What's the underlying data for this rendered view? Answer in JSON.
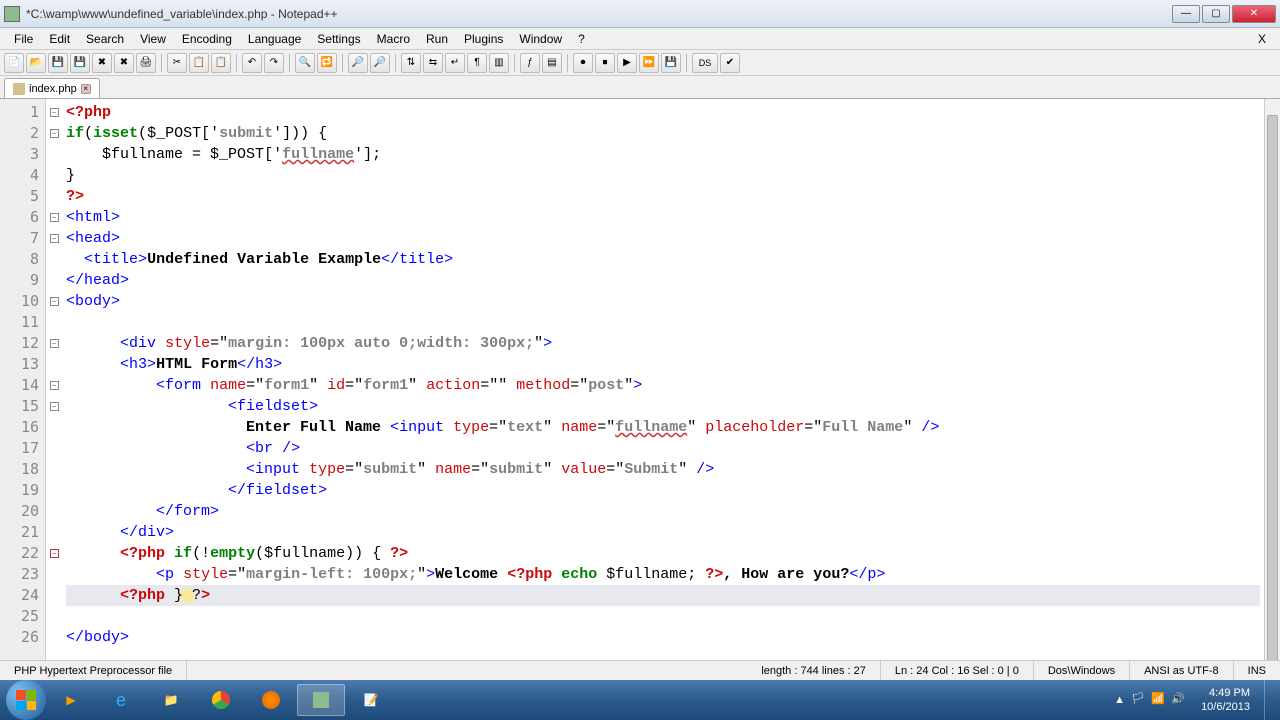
{
  "window": {
    "title": "*C:\\wamp\\www\\undefined_variable\\index.php - Notepad++"
  },
  "menu": {
    "items": [
      "File",
      "Edit",
      "Search",
      "View",
      "Encoding",
      "Language",
      "Settings",
      "Macro",
      "Run",
      "Plugins",
      "Window",
      "?"
    ],
    "close": "X"
  },
  "tab": {
    "label": "index.php"
  },
  "code_lines": [
    "<?php",
    "if(isset($_POST['submit'])) {",
    "    $fullname = $_POST['fullname'];",
    "}",
    "?>",
    "<html>",
    "<head>",
    "  <title>Undefined Variable Example</title>",
    "</head>",
    "<body>",
    "",
    "      <div style=\"margin: 100px auto 0;width: 300px;\">",
    "      <h3>HTML Form</h3>",
    "          <form name=\"form1\" id=\"form1\" action=\"\" method=\"post\">",
    "                  <fieldset>",
    "                    Enter Full Name <input type=\"text\" name=\"fullname\" placeholder=\"Full Name\" />",
    "                    <br />",
    "                    <input type=\"submit\" name=\"submit\" value=\"Submit\" />",
    "                  </fieldset>",
    "          </form>",
    "      </div>",
    "      <?php if(!empty($fullname)) { ?>",
    "          <p style=\"margin-left: 100px;\">Welcome <?php echo $fullname; ?>, How are you?</p>",
    "      <?php } ?>",
    "",
    "</body>"
  ],
  "line_count": 26,
  "statusbar": {
    "filetype": "PHP Hypertext Preprocessor file",
    "length": "length : 744    lines : 27",
    "pos": "Ln : 24    Col : 16    Sel : 0 | 0",
    "eol": "Dos\\Windows",
    "encoding": "ANSI as UTF-8",
    "mode": "INS"
  },
  "tray": {
    "time": "4:49 PM",
    "date": "10/6/2013"
  }
}
